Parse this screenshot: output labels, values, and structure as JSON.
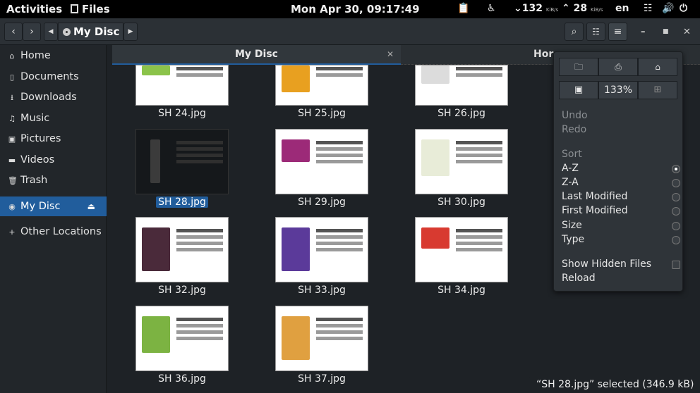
{
  "topbar": {
    "activities": "Activities",
    "app": "Files",
    "clock": "Mon Apr 30, 09:17:49",
    "net_down": "132",
    "net_down_unit": "KiB/s",
    "net_up": "28",
    "net_up_unit": "KiB/s",
    "lang": "en"
  },
  "header": {
    "location": "My Disc"
  },
  "sidebar": {
    "items": [
      {
        "label": "Home",
        "icon": "home-icon"
      },
      {
        "label": "Documents",
        "icon": "document-icon"
      },
      {
        "label": "Downloads",
        "icon": "download-icon"
      },
      {
        "label": "Music",
        "icon": "music-icon"
      },
      {
        "label": "Pictures",
        "icon": "camera-icon"
      },
      {
        "label": "Videos",
        "icon": "video-icon"
      },
      {
        "label": "Trash",
        "icon": "trash-icon"
      },
      {
        "label": "My Disc",
        "icon": "disc-icon"
      },
      {
        "label": "Other Locations",
        "icon": "plus-icon"
      }
    ]
  },
  "tabs": [
    {
      "label": "My Disc"
    },
    {
      "label": "Hor"
    }
  ],
  "files": [
    {
      "name": "SH 24.jpg"
    },
    {
      "name": "SH 25.jpg"
    },
    {
      "name": "SH 26.jpg"
    },
    {
      "name": "SH 28.jpg"
    },
    {
      "name": "SH 29.jpg"
    },
    {
      "name": "SH 30.jpg"
    },
    {
      "name": "SH 32.jpg"
    },
    {
      "name": "SH 33.jpg"
    },
    {
      "name": "SH 34.jpg"
    },
    {
      "name": "SH 36.jpg"
    },
    {
      "name": "SH 37.jpg"
    }
  ],
  "menu": {
    "zoom": "133%",
    "undo": "Undo",
    "redo": "Redo",
    "sort_heading": "Sort",
    "sort_options": [
      "A-Z",
      "Z-A",
      "Last Modified",
      "First Modified",
      "Size",
      "Type"
    ],
    "show_hidden": "Show Hidden Files",
    "reload": "Reload"
  },
  "status": "“SH 28.jpg” selected (346.9 kB)",
  "colors": {
    "accent": "#215d9c"
  }
}
